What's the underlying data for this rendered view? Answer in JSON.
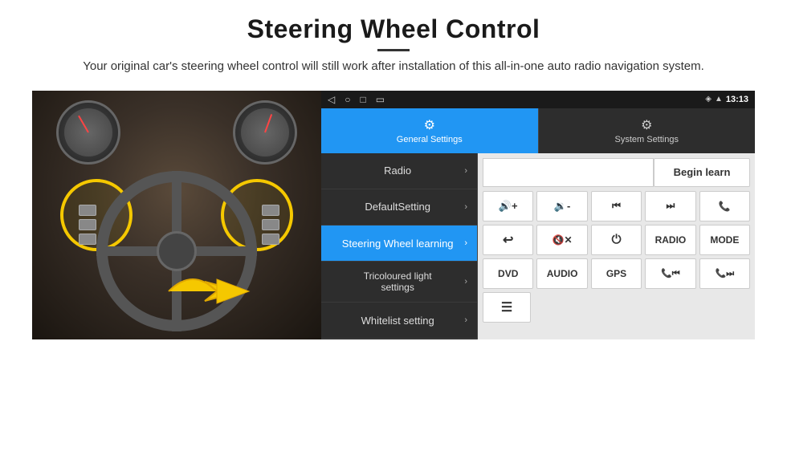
{
  "page": {
    "title": "Steering Wheel Control",
    "subtitle": "Your original car's steering wheel control will still work after installation of this all-in-one auto radio navigation system."
  },
  "status_bar": {
    "time": "13:13",
    "wifi_icon": "wifi",
    "location_icon": "location"
  },
  "tabs": [
    {
      "id": "general",
      "label": "General Settings",
      "active": true,
      "icon": "⚙"
    },
    {
      "id": "system",
      "label": "System Settings",
      "active": false,
      "icon": "🔧"
    }
  ],
  "menu_items": [
    {
      "id": "radio",
      "label": "Radio",
      "active": false
    },
    {
      "id": "default",
      "label": "DefaultSetting",
      "active": false
    },
    {
      "id": "steering",
      "label": "Steering Wheel learning",
      "active": true
    },
    {
      "id": "tricoloured",
      "label": "Tricoloured light settings",
      "active": false
    },
    {
      "id": "whitelist",
      "label": "Whitelist setting",
      "active": false
    }
  ],
  "begin_learn_button": "Begin learn",
  "control_buttons": {
    "row1": [
      {
        "id": "vol-up",
        "label": "🔊+",
        "type": "icon"
      },
      {
        "id": "vol-down",
        "label": "🔉-",
        "type": "icon"
      },
      {
        "id": "prev-track",
        "label": "⏮",
        "type": "icon"
      },
      {
        "id": "next-track",
        "label": "⏭",
        "type": "icon"
      },
      {
        "id": "phone",
        "label": "📞",
        "type": "icon"
      }
    ],
    "row2": [
      {
        "id": "hang-up",
        "label": "↩",
        "type": "icon"
      },
      {
        "id": "mute",
        "label": "🔇x",
        "type": "icon"
      },
      {
        "id": "power",
        "label": "⏻",
        "type": "icon"
      },
      {
        "id": "radio-btn",
        "label": "RADIO",
        "type": "text"
      },
      {
        "id": "mode-btn",
        "label": "MODE",
        "type": "text"
      }
    ],
    "row3": [
      {
        "id": "dvd-btn",
        "label": "DVD",
        "type": "text"
      },
      {
        "id": "audio-btn",
        "label": "AUDIO",
        "type": "text"
      },
      {
        "id": "gps-btn",
        "label": "GPS",
        "type": "text"
      },
      {
        "id": "phone-prev",
        "label": "📞⏮",
        "type": "icon"
      },
      {
        "id": "phone-next",
        "label": "📞⏭",
        "type": "icon"
      }
    ],
    "row4": [
      {
        "id": "menu-icon",
        "label": "≡",
        "type": "icon"
      }
    ]
  }
}
